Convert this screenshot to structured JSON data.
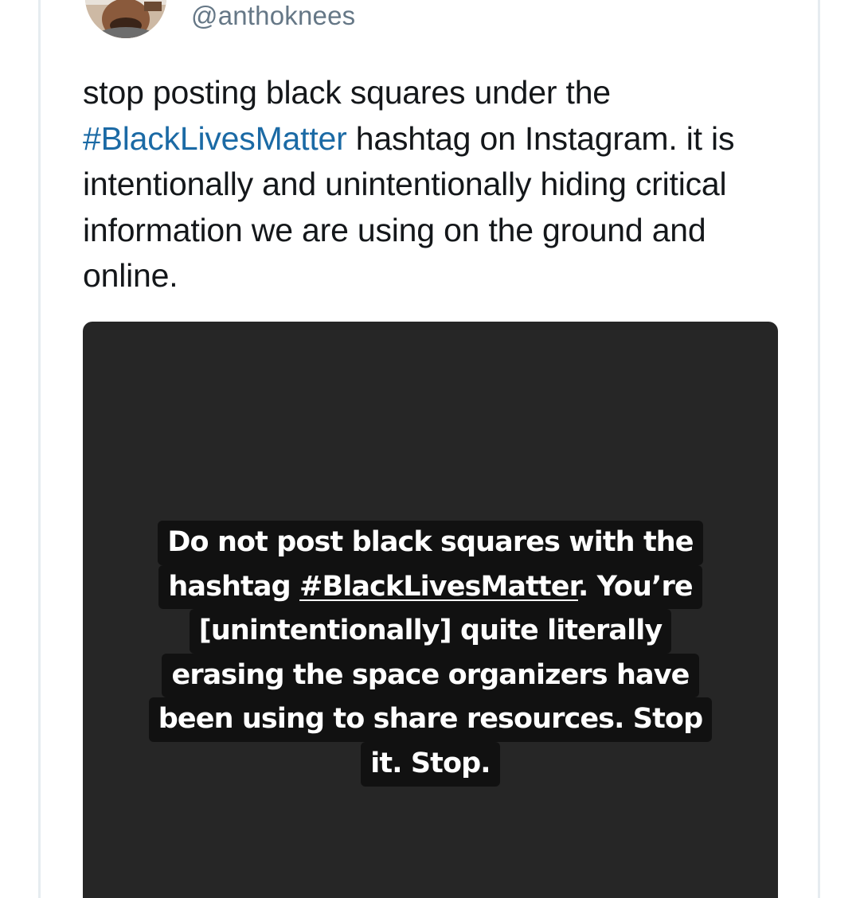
{
  "tweet": {
    "handle": "@anthoknees",
    "text": {
      "before": "stop posting black squares under the ",
      "hashtag": "#BlackLivesMatter",
      "after": " hashtag on Instagram. it is intentionally and unintentionally hiding critical information we are using on the ground and online."
    },
    "link_color": "#1b6aa5",
    "handle_color": "#657786"
  },
  "media": {
    "background_color": "#262626",
    "story_lines": [
      {
        "text": "Do not post black squares with the"
      },
      {
        "pre": "hashtag ",
        "hashtag": "#BlackLivesMatter",
        "post": ". You’re"
      },
      {
        "text": "[unintentionally] quite literally"
      },
      {
        "text": "erasing the space organizers have"
      },
      {
        "text": "been using to share resources. Stop"
      },
      {
        "text": "it. Stop."
      }
    ]
  }
}
